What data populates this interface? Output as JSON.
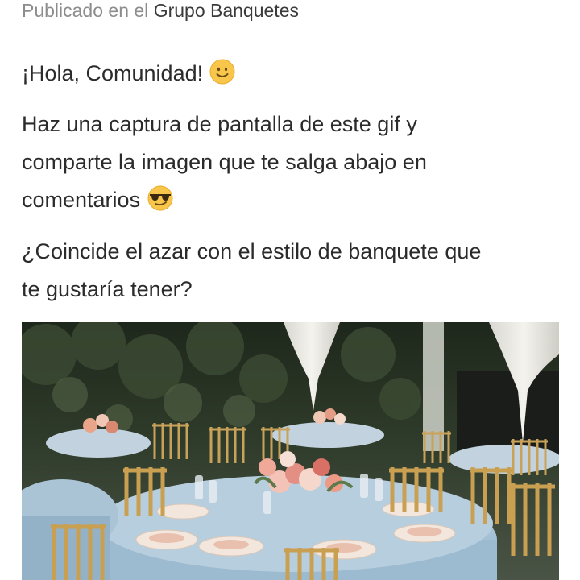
{
  "meta": {
    "prefix": "Publicado en el",
    "group": "Grupo Banquetes"
  },
  "post": {
    "greeting": "¡Hola, Comunidad!",
    "greeting_emoji": "smiling-face-icon",
    "line2_a": "Haz una captura de pantalla de este gif y",
    "line2_b": "comparte la imagen que te salga abajo en",
    "line2_c": "comentarios",
    "line2_emoji": "sunglasses-face-icon",
    "question_a": "¿Coincide el azar con el estilo de banquete que",
    "question_b": "te gustaría tener?"
  },
  "image": {
    "subject": "banquet-tables-photo",
    "colors": {
      "tablecloth": "#a9c4d8",
      "chairs": "#c9a25a",
      "foliage": "#2f3b2a",
      "drape": "#ecebe6"
    }
  }
}
